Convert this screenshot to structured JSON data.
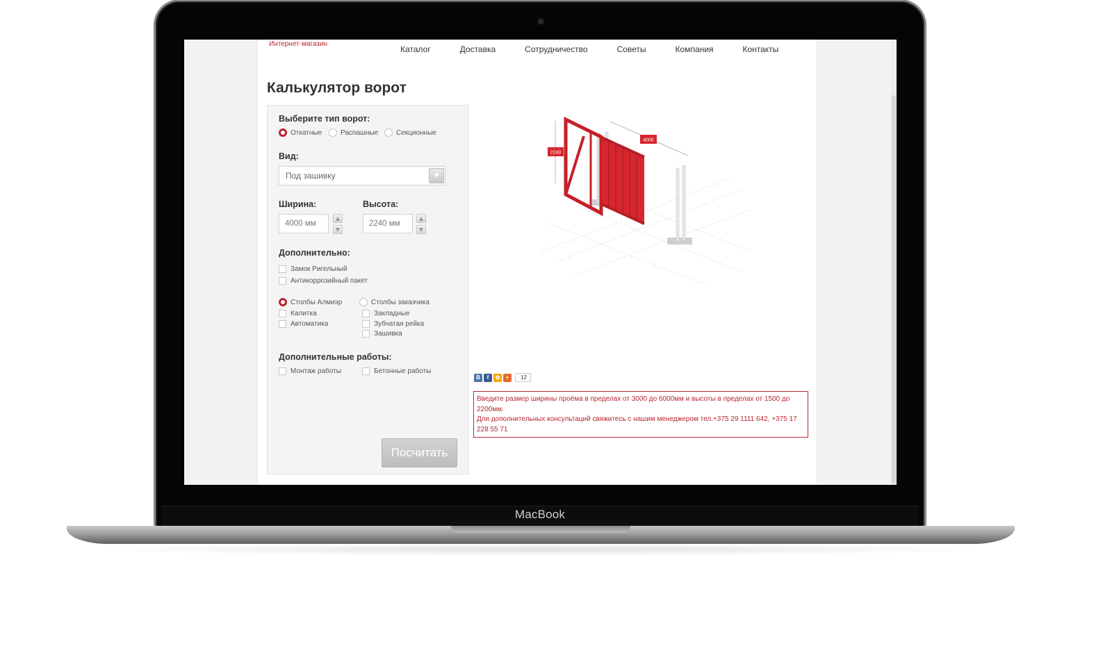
{
  "device": {
    "brand_label": "MacBook"
  },
  "site": {
    "shop_link": "Интернет-магазин",
    "nav": [
      "Каталог",
      "Доставка",
      "Сотрудничество",
      "Советы",
      "Компания",
      "Контакты"
    ],
    "page_title": "Калькулятор ворот"
  },
  "form": {
    "gate_type_label": "Выберите тип ворот:",
    "gate_types": [
      "Откатные",
      "Распашные",
      "Секционные"
    ],
    "gate_type_selected": "Откатные",
    "view_label": "Вид:",
    "view_value": "Под зашивку",
    "width_label": "Ширина:",
    "width_value": "4000 мм",
    "height_label": "Высота:",
    "height_value": "2240 мм",
    "extra_label": "Дополнительно:",
    "extra_checks": [
      "Замок Ригельный",
      "Антикоррозийный пакет"
    ],
    "posts_almir": "Столбы Алмиэр",
    "posts_customer": "Столбы заказчика",
    "left_checks": [
      "Калитка",
      "Автоматика"
    ],
    "right_checks": [
      "Закладные",
      "Зубчатая рейка",
      "Зашивка"
    ],
    "works_label": "Дополнительные работы:",
    "works_checks": [
      "Монтаж работы",
      "Бетонные работы"
    ],
    "submit_label": "Посчитать"
  },
  "illustration": {
    "height_dim": "2240",
    "width_dim": "4000",
    "accent_color": "#d7262e"
  },
  "share": {
    "icons": [
      {
        "name": "vk-icon",
        "glyph": "В",
        "color": "#4a76a8"
      },
      {
        "name": "facebook-icon",
        "glyph": "f",
        "color": "#3b5998"
      },
      {
        "name": "moimir-icon",
        "glyph": "✿",
        "color": "#f7a600"
      },
      {
        "name": "plus-icon",
        "glyph": "+",
        "color": "#e8692e"
      }
    ],
    "count": "12"
  },
  "notice": {
    "line1": "Введите размер ширины проёма в пределах от 3000 до 6000мм и высоты в пределах от 1500 до 2200мм.",
    "line2": "Для дополнительных консультаций свяжитесь с нашим менеджером тел.+375 29 1111 642, +375 17 228 55 71"
  },
  "colors": {
    "brand": "#b9252f"
  }
}
